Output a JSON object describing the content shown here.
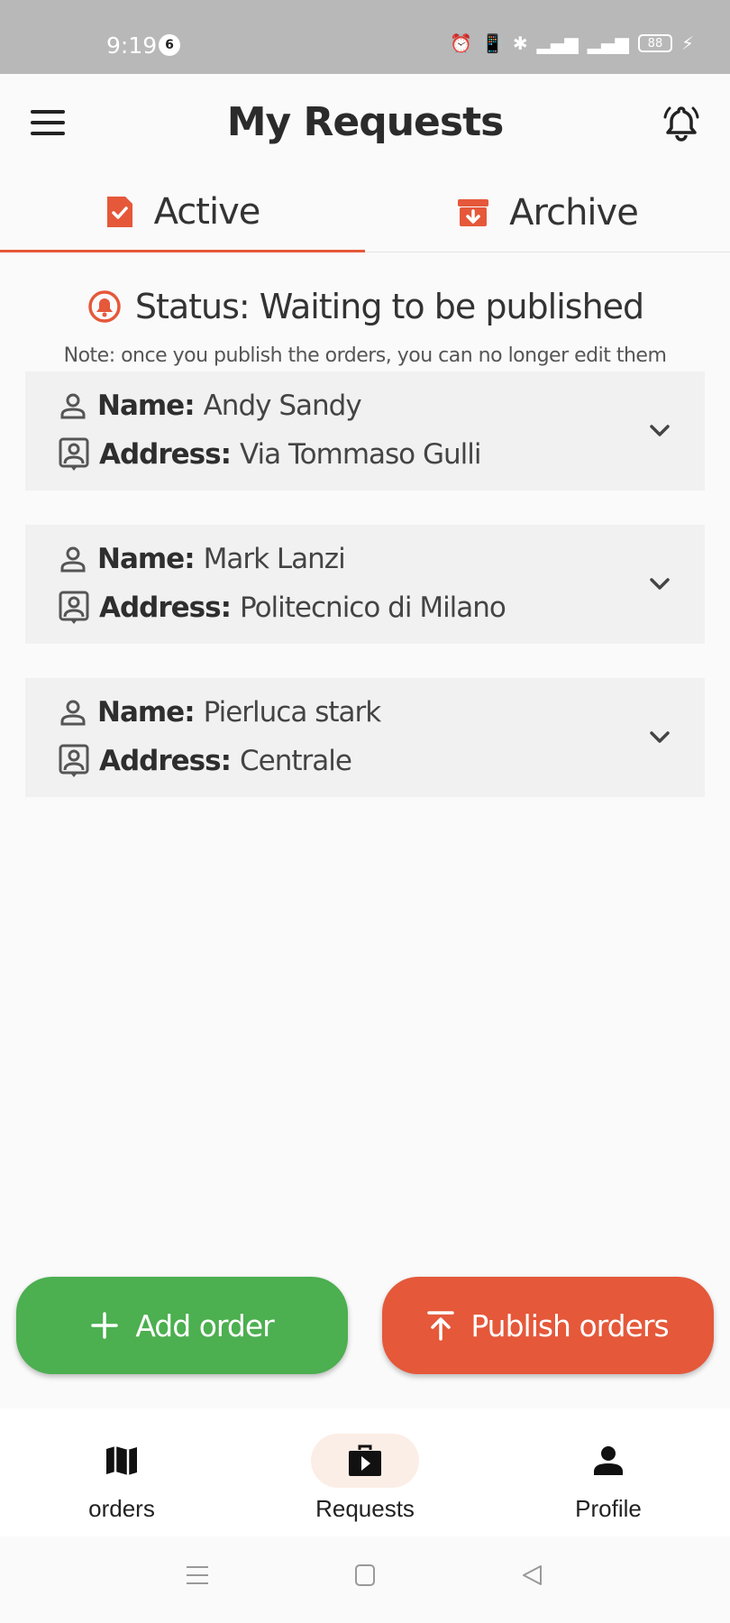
{
  "status_bar": {
    "time": "9:19",
    "notification_count": "6",
    "battery": "88"
  },
  "appbar": {
    "title": "My Requests"
  },
  "tabs": [
    {
      "label": "Active",
      "icon": "file-check-icon",
      "selected": true
    },
    {
      "label": "Archive",
      "icon": "archive-box-icon",
      "selected": false
    }
  ],
  "status": {
    "text": "Status: Waiting to be published",
    "note": "Note: once you publish the orders, you can no longer edit them"
  },
  "labels": {
    "name": "Name:",
    "address": "Address:"
  },
  "orders": [
    {
      "name": "Andy Sandy",
      "address": "Via Tommaso Gulli"
    },
    {
      "name": "Mark Lanzi",
      "address": "Politecnico di Milano"
    },
    {
      "name": "Pierluca stark",
      "address": "Centrale"
    }
  ],
  "actions": {
    "add_label": "Add order",
    "publish_label": "Publish orders"
  },
  "bottom_nav": [
    {
      "label": "orders",
      "icon": "map-icon"
    },
    {
      "label": "Requests",
      "icon": "briefcase-play-icon",
      "selected": true
    },
    {
      "label": "Profile",
      "icon": "person-icon"
    }
  ],
  "colors": {
    "accent": "#e5583a",
    "add": "#4caf50",
    "selected_pill": "#fbeee6"
  }
}
